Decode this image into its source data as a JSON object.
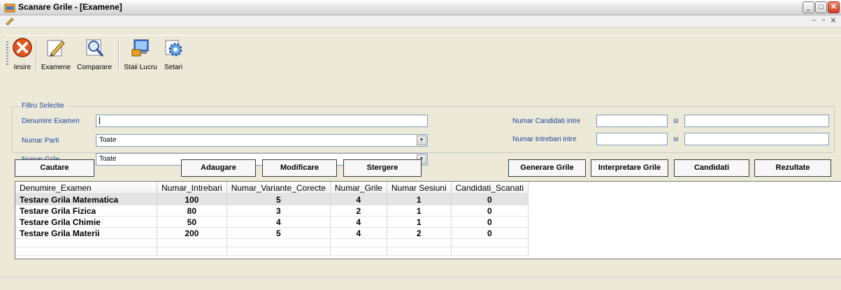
{
  "window": {
    "title": "Scanare Grile - [Examene]"
  },
  "toolbar": {
    "iesire": "Iesire",
    "examene": "Examene",
    "comparare": "Comparare",
    "statii": "Staii Lucru",
    "setari": "Setari"
  },
  "filter": {
    "legend": "Filtru Selectie",
    "denumire_label": "Denumire Examen",
    "denumire_value": "",
    "parti_label": "Numar Parti",
    "parti_value": "Toate",
    "grile_label": "Numar Grile",
    "grile_value": "Toate",
    "candidati_label": "Numar Candidati intre",
    "intrebari_label": "Numar Intrebari intre",
    "si": "si"
  },
  "buttons": {
    "cautare": "Cautare",
    "adaugare": "Adaugare",
    "modificare": "Modificare",
    "stergere": "Stergere",
    "generare": "Generare Grile",
    "interpretare": "Interpretare Grile",
    "candidati": "Candidati",
    "rezultate": "Rezultate"
  },
  "grid": {
    "columns": [
      "Denumire_Examen",
      "Numar_Intrebari",
      "Numar_Variante_Corecte",
      "Numar_Grile",
      "Numar Sesiuni",
      "Candidati_Scanati"
    ],
    "rows": [
      [
        "Testare Grila Matematica",
        "100",
        "5",
        "4",
        "1",
        "0"
      ],
      [
        "Testare Grila Fizica",
        "80",
        "3",
        "2",
        "1",
        "0"
      ],
      [
        "Testare Grila Chimie",
        "50",
        "4",
        "4",
        "1",
        "0"
      ],
      [
        "Testare Grila Materii",
        "200",
        "5",
        "4",
        "2",
        "0"
      ]
    ]
  },
  "icons": {
    "app": "app-icon",
    "iesire": "exit-x-icon",
    "examene": "edit-pencil-icon",
    "comparare": "magnifier-icon",
    "statii": "workstation-icon",
    "setari": "gear-icon"
  },
  "colors": {
    "label": "#17479c",
    "close": "#d23c20"
  }
}
